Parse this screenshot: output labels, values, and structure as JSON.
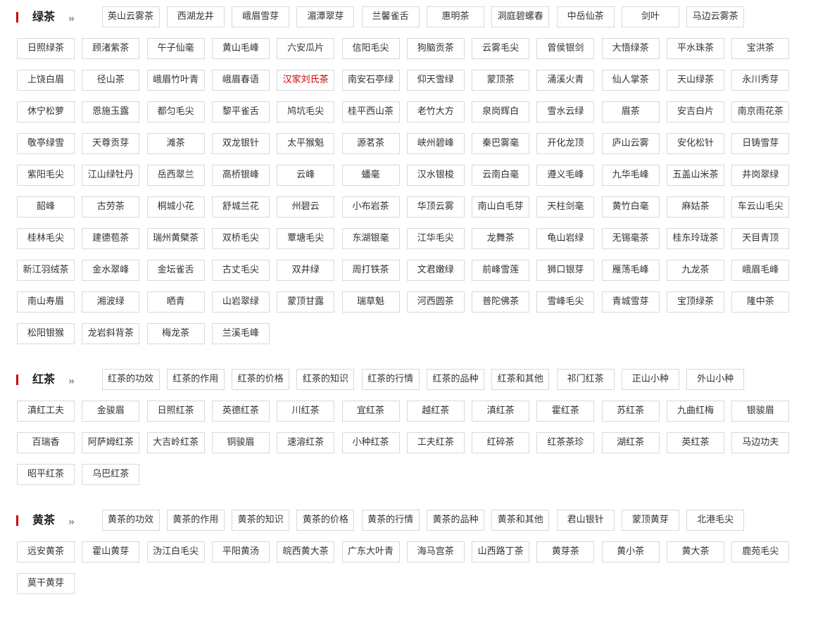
{
  "sections": [
    {
      "title": "绿茶",
      "chevron": "››",
      "header_tags": [
        "英山云雾茶",
        "西湖龙井",
        "峨眉雪芽",
        "湄潭翠芽",
        "兰馨雀舌",
        "惠明茶",
        "洞庭碧螺春",
        "中岳仙茶",
        "剑叶",
        "马边云雾茶"
      ],
      "rows": [
        [
          "日照绿茶",
          "顾渚紫茶",
          "午子仙毫",
          "黄山毛峰",
          "六安瓜片",
          "信阳毛尖",
          "狗脑贡茶",
          "云雾毛尖",
          "曾侯银剑",
          "大悟绿茶",
          "平水珠茶",
          "宝洪茶"
        ],
        [
          "上饶白眉",
          "径山茶",
          "峨眉竹叶青",
          "峨眉春语",
          "汉家刘氏茶",
          "南安石亭绿",
          "仰天雪绿",
          "蒙顶茶",
          "涌溪火青",
          "仙人掌茶",
          "天山绿茶",
          "永川秀芽"
        ],
        [
          "休宁松萝",
          "恩施玉露",
          "都匀毛尖",
          "黎平雀舌",
          "鸠坑毛尖",
          "桂平西山茶",
          "老竹大方",
          "泉岗辉白",
          "雪水云绿",
          "眉茶",
          "安吉白片",
          "南京雨花茶"
        ],
        [
          "敬亭绿雪",
          "天尊贡芽",
          "滩茶",
          "双龙银针",
          "太平猴魁",
          "源茗茶",
          "峡州碧峰",
          "秦巴雾毫",
          "开化龙顶",
          "庐山云雾",
          "安化松针",
          "日铸雪芽"
        ],
        [
          "紫阳毛尖",
          "江山绿牡丹",
          "岳西翠兰",
          "高桥银峰",
          "云峰",
          "蟠毫",
          "汉水银梭",
          "云南白毫",
          "遵义毛峰",
          "九华毛峰",
          "五盖山米茶",
          "井岗翠绿"
        ],
        [
          "韶峰",
          "古劳茶",
          "桐城小花",
          "舒城兰花",
          "州碧云",
          "小布岩茶",
          "华顶云雾",
          "南山白毛芽",
          "天柱剑毫",
          "黄竹白毫",
          "麻姑茶",
          "车云山毛尖"
        ],
        [
          "桂林毛尖",
          "建德苞茶",
          "瑞州黄檗茶",
          "双桥毛尖",
          "覃塘毛尖",
          "东湖银毫",
          "江华毛尖",
          "龙舞茶",
          "龟山岩绿",
          "无锡毫茶",
          "桂东玲珑茶",
          "天目青顶"
        ],
        [
          "新江羽绒茶",
          "金水翠峰",
          "金坛雀舌",
          "古丈毛尖",
          "双井绿",
          "周打铁茶",
          "文君嫩绿",
          "前峰雪莲",
          "狮口银芽",
          "雁荡毛峰",
          "九龙茶",
          "峨眉毛峰"
        ],
        [
          "南山寿眉",
          "湘波绿",
          "晒青",
          "山岩翠绿",
          "蒙顶甘露",
          "瑞草魁",
          "河西圆茶",
          "普陀佛茶",
          "雪峰毛尖",
          "青城雪芽",
          "宝顶绿茶",
          "隆中茶"
        ],
        [
          "松阳银猴",
          "龙岩斜背茶",
          "梅龙茶",
          "兰溪毛峰"
        ]
      ],
      "active_tag": "汉家刘氏茶"
    },
    {
      "title": "红茶",
      "chevron": "››",
      "header_tags": [
        "红茶的功效",
        "红茶的作用",
        "红茶的价格",
        "红茶的知识",
        "红茶的行情",
        "红茶的品种",
        "红茶和其他",
        "祁门红茶",
        "正山小种",
        "外山小种"
      ],
      "rows": [
        [
          "滇红工夫",
          "金骏眉",
          "日照红茶",
          "英德红茶",
          "川红茶",
          "宜红茶",
          "越红茶",
          "滇红茶",
          "霍红茶",
          "苏红茶",
          "九曲红梅",
          "银骏眉"
        ],
        [
          "百瑞香",
          "阿萨姆红茶",
          "大吉岭红茶",
          "铜骏眉",
          "速溶红茶",
          "小种红茶",
          "工夫红茶",
          "红碎茶",
          "红茶茶珍",
          "湖红茶",
          "英红茶",
          "马边功夫"
        ],
        [
          "昭平红茶",
          "乌巴红茶"
        ]
      ]
    },
    {
      "title": "黄茶",
      "chevron": "››",
      "header_tags": [
        "黄茶的功效",
        "黄茶的作用",
        "黄茶的知识",
        "黄茶的价格",
        "黄茶的行情",
        "黄茶的品种",
        "黄茶和其他",
        "君山银针",
        "蒙顶黄芽",
        "北港毛尖"
      ],
      "rows": [
        [
          "远安黄茶",
          "霍山黄芽",
          "沩江白毛尖",
          "平阳黄汤",
          "皖西黄大茶",
          "广东大叶青",
          "海马宫茶",
          "山西路丁茶",
          "黄芽茶",
          "黄小茶",
          "黄大茶",
          "鹿苑毛尖"
        ],
        [
          "莫干黄芽"
        ]
      ]
    }
  ],
  "colors": {
    "accent": "#cc0000",
    "border": "#d9d9d9",
    "text": "#333333"
  }
}
